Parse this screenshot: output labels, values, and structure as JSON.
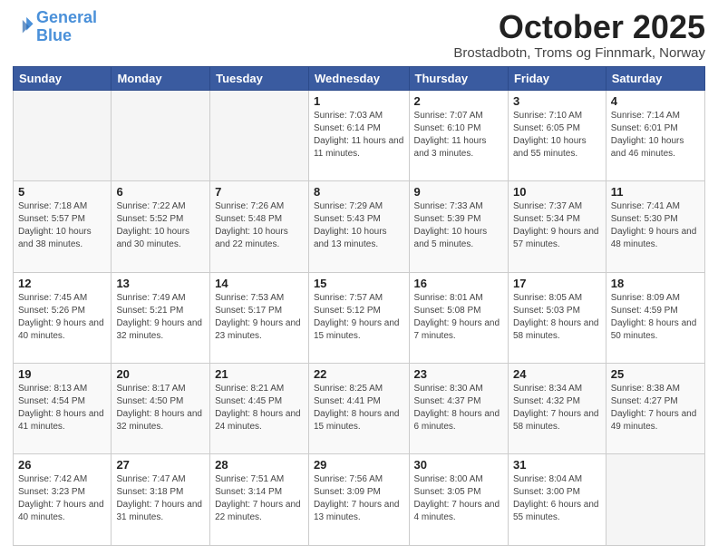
{
  "header": {
    "logo_line1": "General",
    "logo_line2": "Blue",
    "month_title": "October 2025",
    "subtitle": "Brostadbotn, Troms og Finnmark, Norway"
  },
  "weekdays": [
    "Sunday",
    "Monday",
    "Tuesday",
    "Wednesday",
    "Thursday",
    "Friday",
    "Saturday"
  ],
  "weeks": [
    [
      {
        "day": "",
        "empty": true
      },
      {
        "day": "",
        "empty": true
      },
      {
        "day": "",
        "empty": true
      },
      {
        "day": "1",
        "sunrise": "7:03 AM",
        "sunset": "6:14 PM",
        "daylight": "11 hours and 11 minutes."
      },
      {
        "day": "2",
        "sunrise": "7:07 AM",
        "sunset": "6:10 PM",
        "daylight": "11 hours and 3 minutes."
      },
      {
        "day": "3",
        "sunrise": "7:10 AM",
        "sunset": "6:05 PM",
        "daylight": "10 hours and 55 minutes."
      },
      {
        "day": "4",
        "sunrise": "7:14 AM",
        "sunset": "6:01 PM",
        "daylight": "10 hours and 46 minutes."
      }
    ],
    [
      {
        "day": "5",
        "sunrise": "7:18 AM",
        "sunset": "5:57 PM",
        "daylight": "10 hours and 38 minutes."
      },
      {
        "day": "6",
        "sunrise": "7:22 AM",
        "sunset": "5:52 PM",
        "daylight": "10 hours and 30 minutes."
      },
      {
        "day": "7",
        "sunrise": "7:26 AM",
        "sunset": "5:48 PM",
        "daylight": "10 hours and 22 minutes."
      },
      {
        "day": "8",
        "sunrise": "7:29 AM",
        "sunset": "5:43 PM",
        "daylight": "10 hours and 13 minutes."
      },
      {
        "day": "9",
        "sunrise": "7:33 AM",
        "sunset": "5:39 PM",
        "daylight": "10 hours and 5 minutes."
      },
      {
        "day": "10",
        "sunrise": "7:37 AM",
        "sunset": "5:34 PM",
        "daylight": "9 hours and 57 minutes."
      },
      {
        "day": "11",
        "sunrise": "7:41 AM",
        "sunset": "5:30 PM",
        "daylight": "9 hours and 48 minutes."
      }
    ],
    [
      {
        "day": "12",
        "sunrise": "7:45 AM",
        "sunset": "5:26 PM",
        "daylight": "9 hours and 40 minutes."
      },
      {
        "day": "13",
        "sunrise": "7:49 AM",
        "sunset": "5:21 PM",
        "daylight": "9 hours and 32 minutes."
      },
      {
        "day": "14",
        "sunrise": "7:53 AM",
        "sunset": "5:17 PM",
        "daylight": "9 hours and 23 minutes."
      },
      {
        "day": "15",
        "sunrise": "7:57 AM",
        "sunset": "5:12 PM",
        "daylight": "9 hours and 15 minutes."
      },
      {
        "day": "16",
        "sunrise": "8:01 AM",
        "sunset": "5:08 PM",
        "daylight": "9 hours and 7 minutes."
      },
      {
        "day": "17",
        "sunrise": "8:05 AM",
        "sunset": "5:03 PM",
        "daylight": "8 hours and 58 minutes."
      },
      {
        "day": "18",
        "sunrise": "8:09 AM",
        "sunset": "4:59 PM",
        "daylight": "8 hours and 50 minutes."
      }
    ],
    [
      {
        "day": "19",
        "sunrise": "8:13 AM",
        "sunset": "4:54 PM",
        "daylight": "8 hours and 41 minutes."
      },
      {
        "day": "20",
        "sunrise": "8:17 AM",
        "sunset": "4:50 PM",
        "daylight": "8 hours and 32 minutes."
      },
      {
        "day": "21",
        "sunrise": "8:21 AM",
        "sunset": "4:45 PM",
        "daylight": "8 hours and 24 minutes."
      },
      {
        "day": "22",
        "sunrise": "8:25 AM",
        "sunset": "4:41 PM",
        "daylight": "8 hours and 15 minutes."
      },
      {
        "day": "23",
        "sunrise": "8:30 AM",
        "sunset": "4:37 PM",
        "daylight": "8 hours and 6 minutes."
      },
      {
        "day": "24",
        "sunrise": "8:34 AM",
        "sunset": "4:32 PM",
        "daylight": "7 hours and 58 minutes."
      },
      {
        "day": "25",
        "sunrise": "8:38 AM",
        "sunset": "4:27 PM",
        "daylight": "7 hours and 49 minutes."
      }
    ],
    [
      {
        "day": "26",
        "sunrise": "7:42 AM",
        "sunset": "3:23 PM",
        "daylight": "7 hours and 40 minutes."
      },
      {
        "day": "27",
        "sunrise": "7:47 AM",
        "sunset": "3:18 PM",
        "daylight": "7 hours and 31 minutes."
      },
      {
        "day": "28",
        "sunrise": "7:51 AM",
        "sunset": "3:14 PM",
        "daylight": "7 hours and 22 minutes."
      },
      {
        "day": "29",
        "sunrise": "7:56 AM",
        "sunset": "3:09 PM",
        "daylight": "7 hours and 13 minutes."
      },
      {
        "day": "30",
        "sunrise": "8:00 AM",
        "sunset": "3:05 PM",
        "daylight": "7 hours and 4 minutes."
      },
      {
        "day": "31",
        "sunrise": "8:04 AM",
        "sunset": "3:00 PM",
        "daylight": "6 hours and 55 minutes."
      },
      {
        "day": "",
        "empty": true
      }
    ]
  ]
}
